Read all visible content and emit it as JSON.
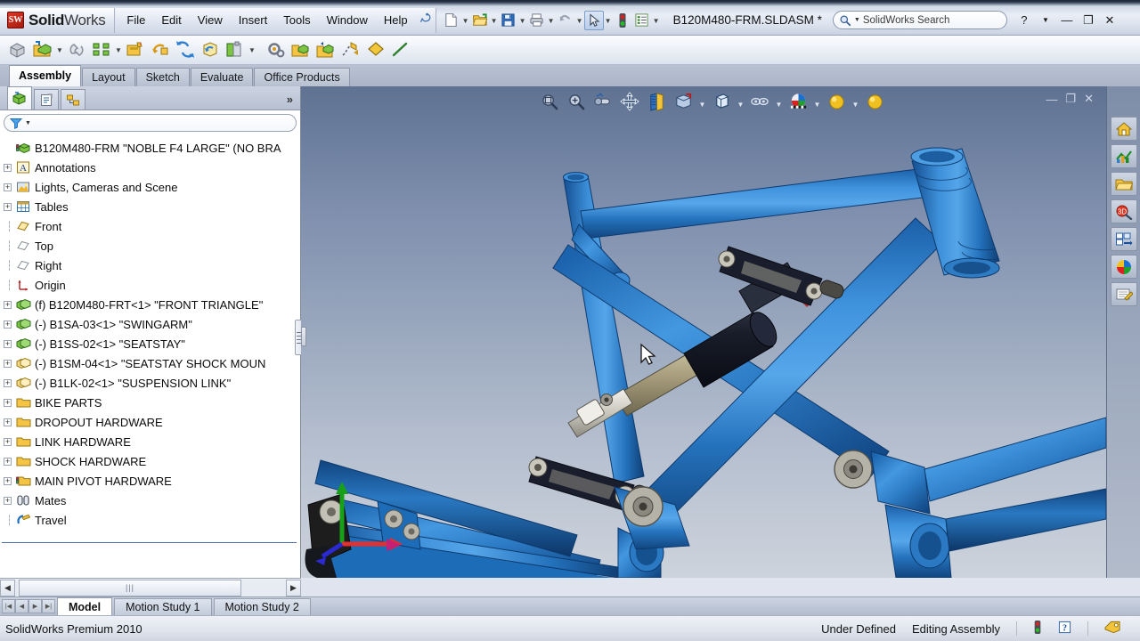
{
  "app": {
    "brand_bold": "Solid",
    "brand_light": "Works",
    "brand_mark": "SW",
    "document_title": "B120M480-FRM.SLDASM *",
    "premium_label": "SolidWorks Premium 2010"
  },
  "menu": {
    "items": [
      "File",
      "Edit",
      "View",
      "Insert",
      "Tools",
      "Window",
      "Help"
    ],
    "pin_icon": "pushpin-icon"
  },
  "search": {
    "placeholder": "SolidWorks Search",
    "icon": "search-icon",
    "dropdown_icon": "chevron-down-icon"
  },
  "window_controls": {
    "help": "?",
    "help_caret": "chevron-down-icon",
    "minimize": "minimize-icon",
    "maximize": "maximize-icon",
    "close": "close-icon"
  },
  "quick_access": [
    {
      "name": "new-document-icon",
      "caret": true
    },
    {
      "name": "open-document-icon",
      "caret": true
    },
    {
      "name": "save-icon",
      "caret": true
    },
    {
      "name": "print-icon",
      "caret": true
    },
    {
      "name": "undo-icon",
      "caret": true
    },
    {
      "name": "select-arrow-icon",
      "caret": true,
      "selected": true
    },
    {
      "name": "rebuild-traffic-light-icon",
      "caret": false
    },
    {
      "name": "options-icon",
      "caret": true
    }
  ],
  "command_toolbar": [
    {
      "name": "edit-component-icon",
      "caret": false
    },
    {
      "name": "insert-components-icon",
      "caret": true
    },
    {
      "name": "mate-icon",
      "caret": false
    },
    {
      "name": "linear-component-pattern-icon",
      "caret": true
    },
    {
      "name": "smart-fasteners-icon",
      "caret": false
    },
    {
      "name": "move-component-icon",
      "caret": false
    },
    {
      "name": "show-hidden-components-icon",
      "caret": false
    },
    {
      "name": "assembly-features-icon",
      "caret": false
    },
    {
      "name": "reference-geometry-icon",
      "caret": true
    },
    {
      "name": "new-motion-study-icon",
      "caret": false
    },
    {
      "name": "bill-of-materials-icon",
      "caret": false
    },
    {
      "name": "exploded-view-icon",
      "caret": false
    },
    {
      "name": "explode-line-sketch-icon",
      "caret": false
    },
    {
      "name": "instant3d-icon",
      "caret": false
    },
    {
      "name": "line-sketch-icon",
      "caret": false
    }
  ],
  "command_manager_tabs": [
    {
      "label": "Assembly",
      "active": true
    },
    {
      "label": "Layout",
      "active": false
    },
    {
      "label": "Sketch",
      "active": false
    },
    {
      "label": "Evaluate",
      "active": false
    },
    {
      "label": "Office Products",
      "active": false
    }
  ],
  "left_panel": {
    "tabs": [
      {
        "name": "feature-manager-tab",
        "icon": "feature-tree-icon",
        "active": true
      },
      {
        "name": "property-manager-tab",
        "icon": "property-manager-icon",
        "active": false
      },
      {
        "name": "configuration-manager-tab",
        "icon": "configuration-manager-icon",
        "active": false
      }
    ],
    "expand_chevron": "chevron-double-right-icon",
    "filter": {
      "icon": "filter-icon",
      "caret": "chevron-down-icon",
      "value": ""
    },
    "tree": [
      {
        "label": "B120M480-FRM \"NOBLE F4 LARGE\"  (NO BRA",
        "icon": "assembly-icon",
        "indent": 0,
        "expandable": false,
        "root": true
      },
      {
        "label": "Annotations",
        "icon": "annotations-icon",
        "indent": 1,
        "expandable": true
      },
      {
        "label": "Lights, Cameras and Scene",
        "icon": "lights-cameras-scene-icon",
        "indent": 1,
        "expandable": true
      },
      {
        "label": "Tables",
        "icon": "tables-icon",
        "indent": 1,
        "expandable": true
      },
      {
        "label": "Front",
        "icon": "plane-icon",
        "indent": 1,
        "expandable": false
      },
      {
        "label": "Top",
        "icon": "plane-icon",
        "indent": 1,
        "expandable": false
      },
      {
        "label": "Right",
        "icon": "plane-icon",
        "indent": 1,
        "expandable": false
      },
      {
        "label": "Origin",
        "icon": "origin-icon",
        "indent": 1,
        "expandable": false
      },
      {
        "label": "(f) B120M480-FRT<1> \"FRONT TRIANGLE\"",
        "icon": "part-icon",
        "indent": 1,
        "expandable": true
      },
      {
        "label": "(-) B1SA-03<1> \"SWINGARM\"",
        "icon": "part-icon",
        "indent": 1,
        "expandable": true
      },
      {
        "label": "(-) B1SS-02<1> \"SEATSTAY\"",
        "icon": "part-icon",
        "indent": 1,
        "expandable": true
      },
      {
        "label": "(-) B1SM-04<1> \"SEATSTAY SHOCK MOUN",
        "icon": "part-yellow-icon",
        "indent": 1,
        "expandable": true
      },
      {
        "label": "(-) B1LK-02<1> \"SUSPENSION LINK\"",
        "icon": "part-yellow-icon",
        "indent": 1,
        "expandable": true
      },
      {
        "label": "BIKE PARTS",
        "icon": "folder-icon",
        "indent": 1,
        "expandable": true
      },
      {
        "label": "DROPOUT HARDWARE",
        "icon": "folder-icon",
        "indent": 1,
        "expandable": true
      },
      {
        "label": "LINK HARDWARE",
        "icon": "folder-icon",
        "indent": 1,
        "expandable": true
      },
      {
        "label": "SHOCK HARDWARE",
        "icon": "folder-icon",
        "indent": 1,
        "expandable": true
      },
      {
        "label": "MAIN PIVOT HARDWARE",
        "icon": "folder-status-icon",
        "indent": 1,
        "expandable": true
      },
      {
        "label": "Mates",
        "icon": "mates-icon",
        "indent": 1,
        "expandable": true
      },
      {
        "label": "Travel",
        "icon": "travel-sketch-icon",
        "indent": 1,
        "expandable": false
      }
    ]
  },
  "tree_scrollbar": {
    "left_arrow": "chevron-left-icon",
    "right_arrow": "chevron-right-icon",
    "thumb_grip": "|||"
  },
  "view_toolbar": [
    {
      "name": "zoom-to-fit-icon",
      "caret": false
    },
    {
      "name": "zoom-to-area-icon",
      "caret": false
    },
    {
      "name": "previous-view-icon",
      "caret": false
    },
    {
      "name": "pan-icon",
      "caret": false
    },
    {
      "name": "section-view-icon",
      "caret": false
    },
    {
      "name": "view-orientation-icon",
      "caret": true
    },
    {
      "name": "display-style-icon",
      "caret": true
    },
    {
      "name": "hide-show-items-icon",
      "caret": true
    },
    {
      "name": "appearances-icon",
      "caret": true
    },
    {
      "name": "apply-scene-icon",
      "caret": true
    },
    {
      "name": "view-settings-icon",
      "caret": false
    }
  ],
  "document_window_controls": {
    "minimize": "minimize-icon",
    "restore": "restore-icon",
    "close": "close-icon"
  },
  "task_pane": [
    {
      "name": "solidworks-resources-icon"
    },
    {
      "name": "design-library-icon"
    },
    {
      "name": "file-explorer-icon"
    },
    {
      "name": "search-3d-contentcentral-icon"
    },
    {
      "name": "view-palette-icon"
    },
    {
      "name": "appearances-scenes-icon"
    },
    {
      "name": "custom-properties-icon"
    }
  ],
  "bottom_tabs": {
    "nav_buttons": [
      "first-icon",
      "previous-icon",
      "next-icon",
      "last-icon"
    ],
    "tabs": [
      {
        "label": "Model",
        "active": true
      },
      {
        "label": "Motion Study 1",
        "active": false
      },
      {
        "label": "Motion Study 2",
        "active": false
      }
    ]
  },
  "status_bar": {
    "left": "SolidWorks Premium 2010",
    "state": "Under Defined",
    "mode": "Editing Assembly",
    "rebuild_icon": "traffic-light-icon",
    "help_icon": "question-mark-icon",
    "tag_icon": "tag-icon"
  },
  "viewport": {
    "model_name": "bicycle-frame-assembly",
    "cursor": "arrow-cursor",
    "frame_color": "#1f6fc0",
    "frame_color_light": "#4f9fe0",
    "frame_color_dark": "#14518f",
    "shock_body_color": "#1c1f2b",
    "shock_shaft_color": "#a59c7d",
    "link_color": "#d8d5cc",
    "background_top": "#5f7292",
    "background_bottom": "#cdd3dc",
    "triad": {
      "x_axis_color": "#e03030",
      "y_axis_color": "#19a019",
      "z_axis_color": "#2a2ad0"
    }
  }
}
